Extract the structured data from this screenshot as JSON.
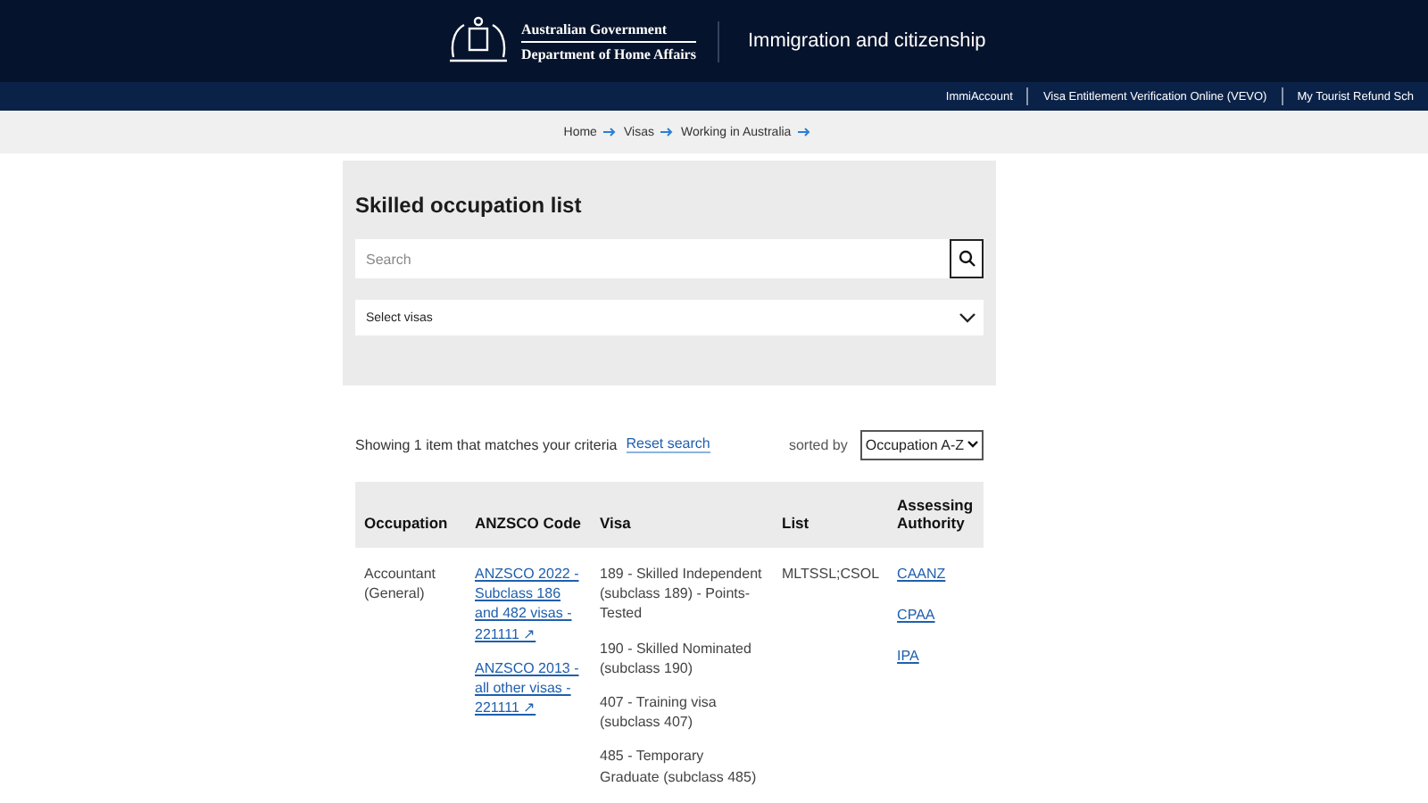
{
  "header": {
    "logo_line_1": "Australian Government",
    "logo_line_2": "Department of Home Affairs",
    "site_title": "Immigration and citizenship"
  },
  "top_links": [
    "ImmiAccount",
    "Visa Entitlement Verification Online (VEVO)",
    "My Tourist Refund Sch"
  ],
  "breadcrumbs": [
    "Home",
    "Visas",
    "Working in Australia"
  ],
  "search_panel": {
    "title": "Skilled occupation list",
    "search": {
      "placeholder": "Search"
    },
    "visa_select": {
      "value": "Select visas"
    }
  },
  "results": {
    "summary": "Showing 1 item that matches your criteria",
    "reset_link": "Reset search",
    "sort_label": "sorted by",
    "sort_value": "Occupation A-Z"
  },
  "table": {
    "columns": [
      "Occupation",
      "ANZSCO Code",
      "Visa",
      "List",
      "Assessing Authority"
    ],
    "rows": [
      {
        "occupation": "Accountant (General)",
        "anzsco_links": [
          "ANZSCO 2022 - Subclass 186 and 482 visas - 221111 ↗",
          "ANZSCO 2013 - all other visas - 221111 ↗"
        ],
        "visas": [
          "189 - Skilled Independent (subclass 189) - Points-Tested",
          "190 - Skilled Nominated (subclass 190)",
          "407 - Training visa (subclass 407)",
          "485 - Temporary Graduate (subclass 485)"
        ],
        "list": "MLTSSL;CSOL",
        "authorities": [
          "CAANZ",
          "CPAA",
          "IPA"
        ]
      }
    ]
  }
}
